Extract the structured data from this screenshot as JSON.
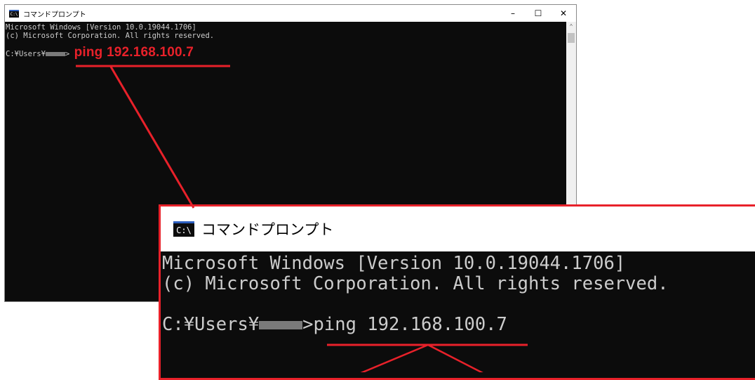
{
  "window": {
    "title": "コマンドプロンプト",
    "icon_text": "C:\\",
    "controls": {
      "minimize": "–",
      "maximize": "☐",
      "close": "✕"
    },
    "scroll_up": "^"
  },
  "console": {
    "line1": "Microsoft Windows [Version 10.0.19044.1706]",
    "line2": "(c) Microsoft Corporation. All rights reserved.",
    "prompt_prefix": "C:¥Users¥",
    "prompt_suffix": ">",
    "command": "ping 192.168.100.7"
  },
  "colors": {
    "console_bg": "#0c0c0c",
    "console_text": "#cccccc",
    "highlight": "#e8212a"
  }
}
